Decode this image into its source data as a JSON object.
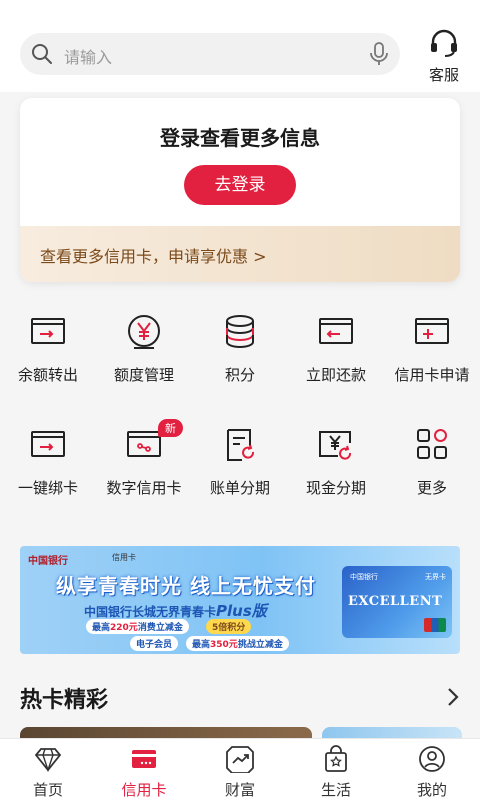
{
  "search": {
    "placeholder": "请输入"
  },
  "header": {
    "service_label": "客服"
  },
  "login_card": {
    "title": "登录查看更多信息",
    "login_button": "去登录",
    "promo_text": "查看更多信用卡，申请享优惠 >"
  },
  "services_row1": [
    {
      "label": "余额转出",
      "icon": "card-transfer-out-icon"
    },
    {
      "label": "额度管理",
      "icon": "yen-limit-icon"
    },
    {
      "label": "积分",
      "icon": "points-coins-icon"
    },
    {
      "label": "立即还款",
      "icon": "card-repay-icon"
    },
    {
      "label": "信用卡申请",
      "icon": "card-apply-icon"
    }
  ],
  "services_row2": [
    {
      "label": "一键绑卡",
      "icon": "card-bind-icon"
    },
    {
      "label": "数字信用卡",
      "icon": "digital-card-icon",
      "badge": "新"
    },
    {
      "label": "账单分期",
      "icon": "bill-installment-icon"
    },
    {
      "label": "现金分期",
      "icon": "cash-installment-icon"
    },
    {
      "label": "更多",
      "icon": "grid-more-icon"
    }
  ],
  "banner": {
    "brand": "中国银行",
    "brand_sub": "信用卡",
    "slogan": "纵享青春时光 线上无忧支付",
    "subtitle_main": "中国银行长城无界青春卡",
    "subtitle_plus": "Plus版",
    "chip1_pre": "最高",
    "chip1_amount": "220元",
    "chip1_post": "消费立减金",
    "chip2": "5倍积分",
    "chip3": "电子会员",
    "chip4_pre": "最高",
    "chip4_amount": "350元",
    "chip4_post": "挑战立减金",
    "card_brand": "中国银行",
    "card_name": "无界卡",
    "card_word": "EXCELLENT"
  },
  "hot_cards": {
    "title": "热卡精彩"
  },
  "tabs": [
    {
      "label": "首页",
      "icon": "diamond-icon"
    },
    {
      "label": "信用卡",
      "icon": "credit-card-icon",
      "active": true
    },
    {
      "label": "财富",
      "icon": "trend-chart-icon"
    },
    {
      "label": "生活",
      "icon": "shopping-bag-icon"
    },
    {
      "label": "我的",
      "icon": "user-icon"
    }
  ],
  "colors": {
    "accent": "#e2203f",
    "promo_text": "#7b4a1b",
    "banner_blue": "#1d56b4"
  }
}
